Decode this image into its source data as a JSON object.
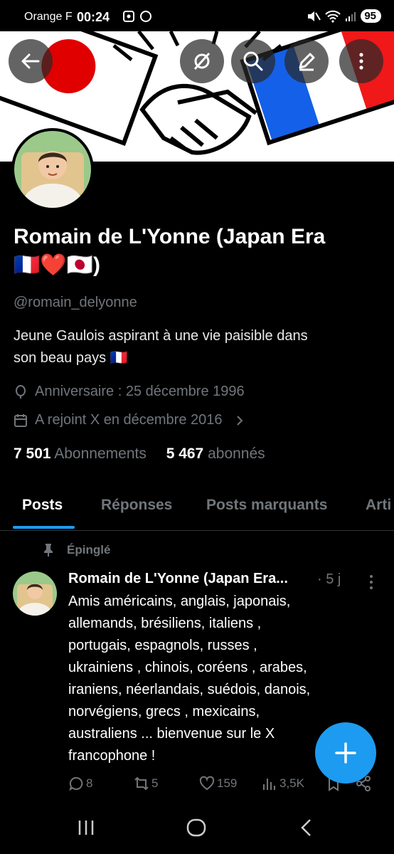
{
  "status_bar": {
    "carrier": "Orange F",
    "time": "00:24",
    "battery": "95"
  },
  "header": {
    "back_icon": "arrow-left-icon",
    "grok_icon": "grok-icon",
    "search_icon": "search-icon",
    "edit_icon": "pencil-icon",
    "more_icon": "more-vertical-icon"
  },
  "profile": {
    "name_line1": "Romain de L'Yonne (Japan Era",
    "name_line2": "🇫🇷❤️🇯🇵)",
    "handle": "@romain_delyonne",
    "bio_line1": "Jeune Gaulois aspirant à une vie paisible dans",
    "bio_line2": "son beau pays 🇫🇷",
    "birthday": "Anniversaire : 25 décembre 1996",
    "joined": "A rejoint X en décembre 2016",
    "following_count": "7 501",
    "following_label": "Abonnements",
    "followers_count": "5 467",
    "followers_label": "abonnés"
  },
  "tabs": [
    {
      "label": "Posts",
      "active": true
    },
    {
      "label": "Réponses",
      "active": false
    },
    {
      "label": "Posts marquants",
      "active": false
    },
    {
      "label": "Arti",
      "active": false
    }
  ],
  "post": {
    "pinned_label": "Épinglé",
    "author": "Romain de L'Yonne (Japan Era...",
    "time": "· 5 j",
    "text": "Amis américains,  anglais,  japonais,\nallemands,  brésiliens,  italiens ,\nportugais,  espagnols,  russes ,\nukrainiens , chinois,  coréens , arabes,\niraniens, néerlandais, suédois,  danois,\nnorvégiens,  grecs , mexicains,\naustraliens ... bienvenue sur le X\nfrancophone !",
    "replies": "8",
    "reposts": "5",
    "likes": "159",
    "views": "3,5K"
  },
  "colors": {
    "accent": "#1d9bf0",
    "muted": "#71767b",
    "background": "#000000"
  }
}
